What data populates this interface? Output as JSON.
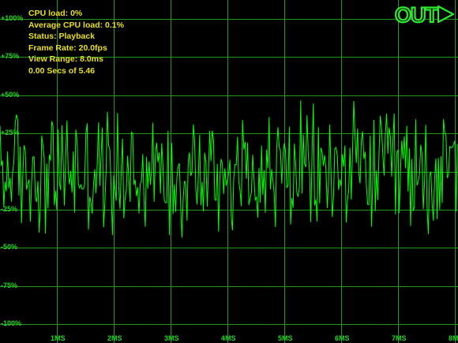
{
  "status": {
    "cpu_load": "CPU load: 0%",
    "avg_cpu_load": "Average CPU load: 0.1%",
    "status": "Status: Playback",
    "frame_rate": "Frame Rate: 20.0fps",
    "view_range": "View Range: 8.0ms",
    "position": "0.00 Secs of 5.46"
  },
  "out_button": {
    "label": "OUT",
    "icon": "play-triangle-icon"
  },
  "y_axis": {
    "ticks": [
      "+100%",
      "+75%",
      "+50%",
      "+25%",
      "-25%",
      "-50%",
      "-75%",
      "-100%"
    ],
    "range_percent": [
      -100,
      100
    ]
  },
  "x_axis": {
    "ticks": [
      "1MS",
      "2MS",
      "3MS",
      "4MS",
      "5MS",
      "6MS",
      "7MS",
      "8M"
    ],
    "range_ms": [
      0,
      8
    ]
  },
  "waveform": {
    "type": "noise",
    "amplitude_percent": 50,
    "color": "#00ff00"
  },
  "colors": {
    "background": "#000000",
    "grid": "#1f9a1f",
    "labels": "#22d322",
    "status_text": "#e8e01a",
    "waveform": "#00ff00"
  }
}
